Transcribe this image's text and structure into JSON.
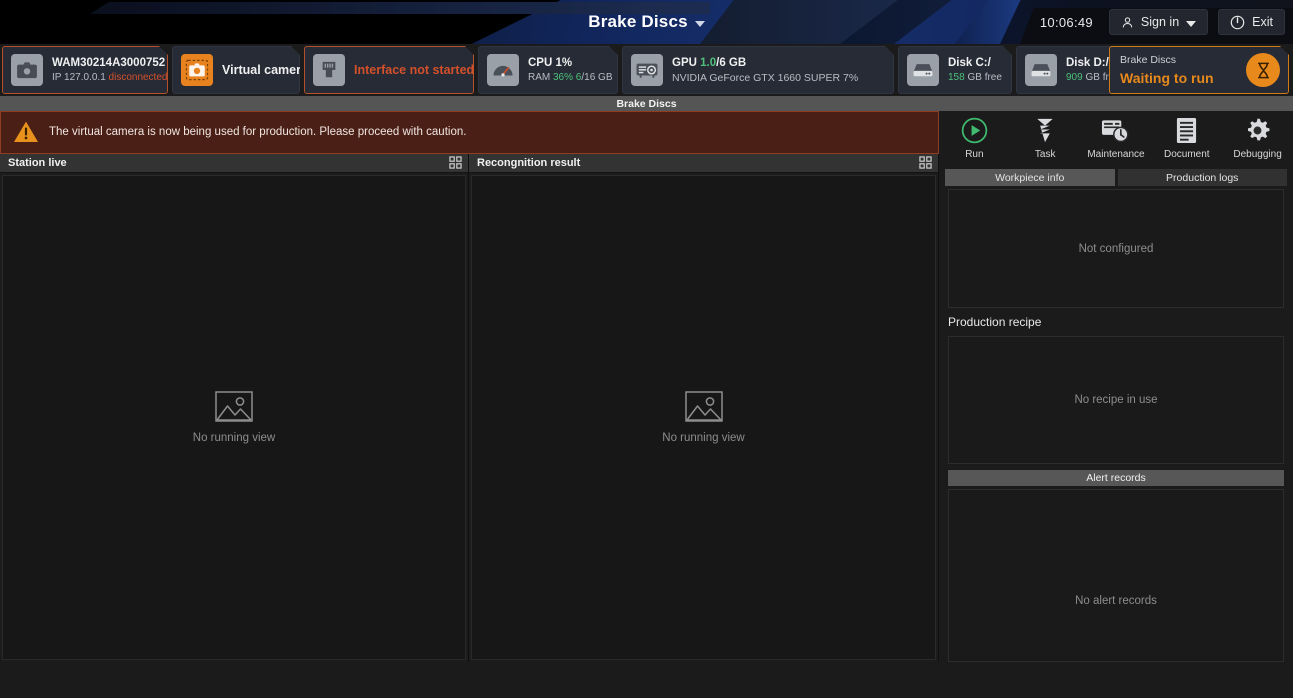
{
  "titlebar": {
    "title": "Brake Discs",
    "clock": "10:06:49",
    "sign_in_label": "Sign in",
    "exit_label": "Exit"
  },
  "status_tiles": {
    "camera": {
      "name": "WAM30214A3000752",
      "ip_label": "IP 127.0.0.1",
      "connection": "disconnected",
      "icon": "camera-icon"
    },
    "virtual_camera": {
      "label": "Virtual camera",
      "icon": "virtual-camera-icon"
    },
    "interface": {
      "label": "Interface not started",
      "icon": "ethernet-port-icon"
    },
    "cpu": {
      "line1": "CPU 1%",
      "ram_prefix": "RAM ",
      "ram_pct": "36%",
      "ram_used": " 6",
      "ram_total": "/16 GB",
      "icon": "gauge-icon"
    },
    "gpu": {
      "prefix": "GPU ",
      "used": "1.0",
      "total": "/6 GB",
      "model": "NVIDIA GeForce GTX 1660 SUPER 7%",
      "icon": "gpu-card-icon"
    },
    "disk_c": {
      "label": "Disk C:/",
      "free_value": "158",
      "free_suffix": " GB free",
      "icon": "disk-icon"
    },
    "disk_d": {
      "label": "Disk D:/",
      "free_value": "909",
      "free_suffix": " GB free",
      "icon": "disk-icon"
    },
    "run_status": {
      "name": "Brake Discs",
      "state": "Waiting to run",
      "icon": "hourglass-icon"
    }
  },
  "tabstrip": {
    "active_tab": "Brake Discs"
  },
  "warning": {
    "icon": "warning-triangle-icon",
    "text": "The virtual camera is now being used for production. Please proceed with caution."
  },
  "panels": {
    "station_live": {
      "title": "Station live",
      "grid_icon": "grid-layout-icon",
      "empty_text": "No running view",
      "empty_icon": "image-placeholder-icon"
    },
    "recognition_result": {
      "title": "Recongnition result",
      "grid_icon": "grid-layout-icon",
      "empty_text": "No running view",
      "empty_icon": "image-placeholder-icon"
    }
  },
  "sidebar": {
    "tools": [
      {
        "label": "Run",
        "icon": "play-circle-icon"
      },
      {
        "label": "Task",
        "icon": "screw-icon"
      },
      {
        "label": "Maintenance",
        "icon": "maintenance-wrench-icon"
      },
      {
        "label": "Document",
        "icon": "document-icon"
      },
      {
        "label": "Debugging",
        "icon": "gear-icon"
      }
    ],
    "subtabs": [
      {
        "label": "Workpiece info",
        "active": true
      },
      {
        "label": "Production logs",
        "active": false
      }
    ],
    "workpiece_empty": "Not configured",
    "recipe_title": "Production recipe",
    "recipe_empty": "No recipe in use",
    "alert_tab": "Alert records",
    "alert_empty": "No alert records"
  },
  "colors": {
    "accent_blue": "#16306f",
    "accent_orange": "#e8891c",
    "error_red": "#d4502a",
    "ok_green": "#4ec07a",
    "warn_bg": "#4a1f16"
  }
}
